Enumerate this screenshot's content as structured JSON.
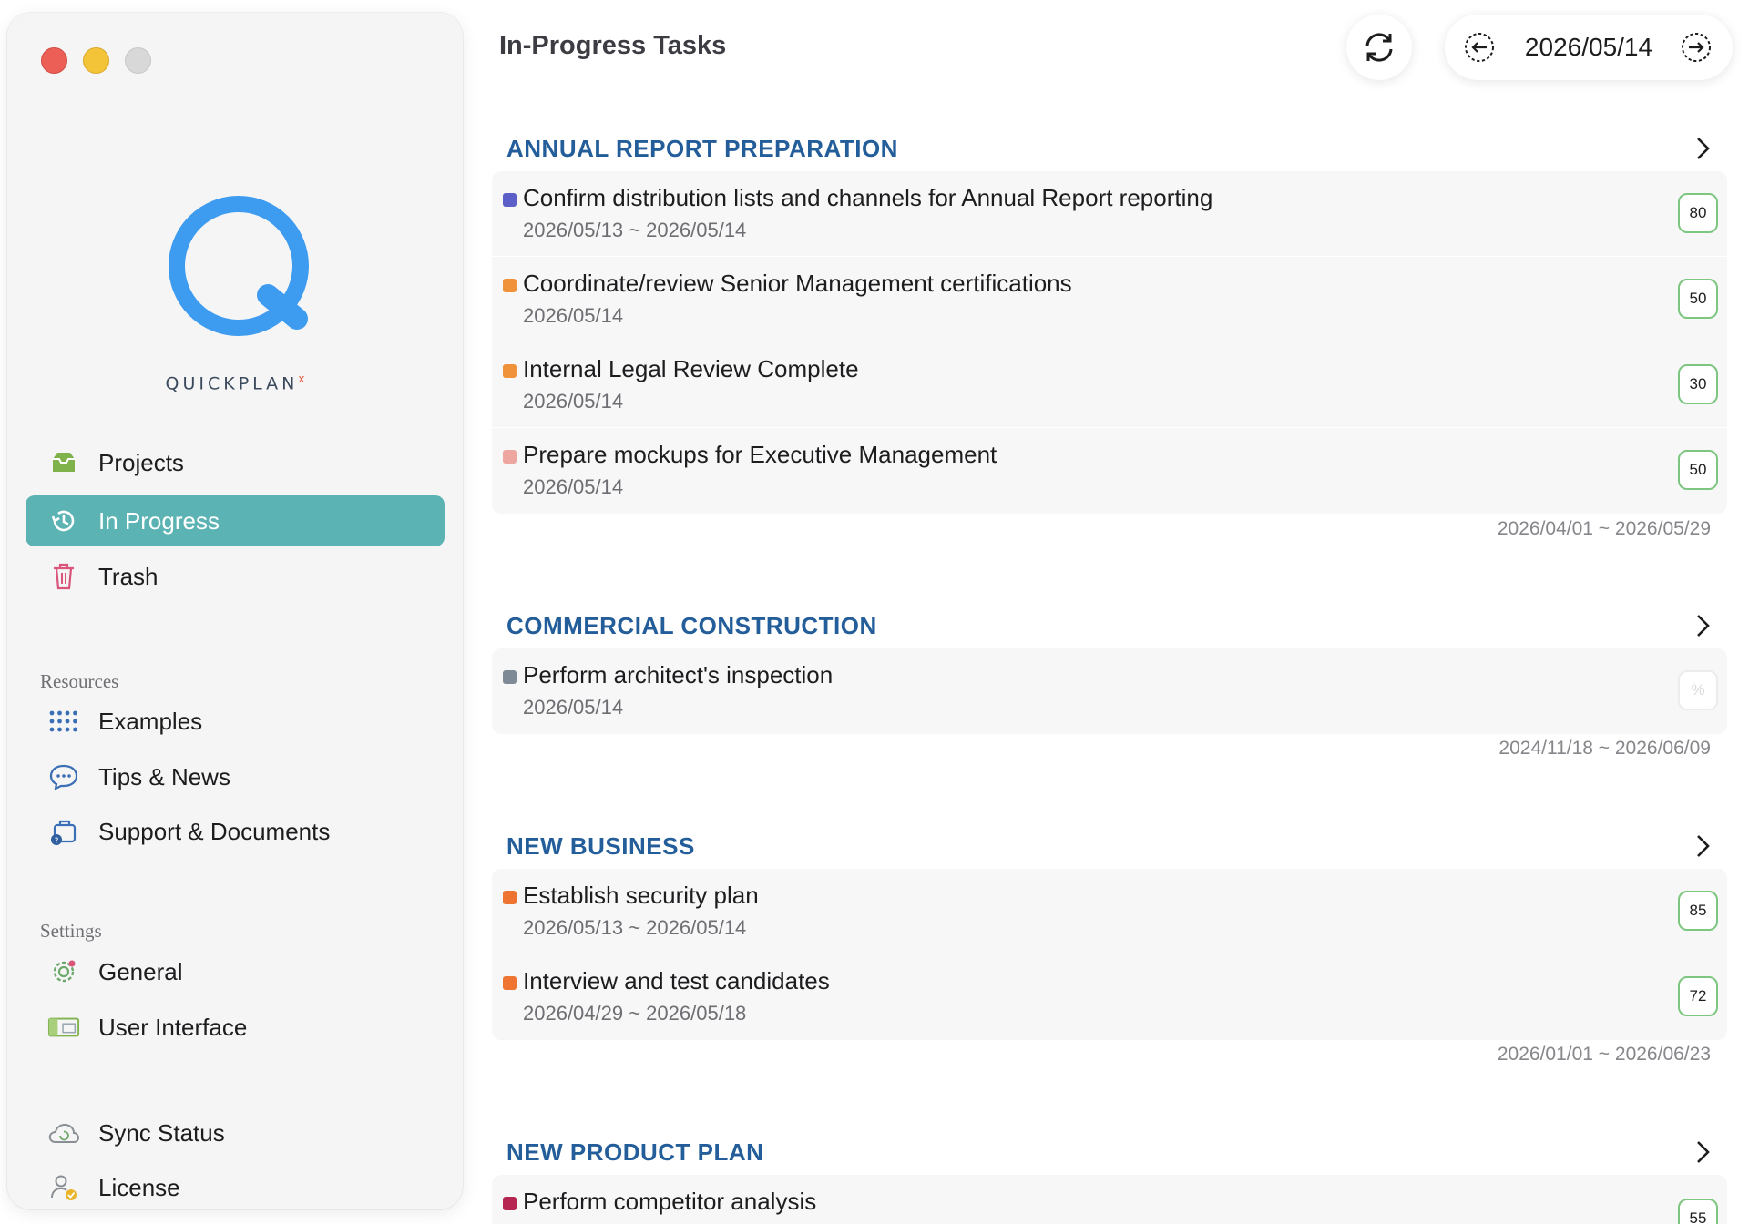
{
  "window": {
    "controls": [
      "close",
      "minimize",
      "zoom"
    ]
  },
  "brand": {
    "name": "QUICKPLAN",
    "mark": "x",
    "accent": "#3d9bf0"
  },
  "sidebar": {
    "nav": [
      {
        "label": "Projects",
        "icon": "tray-icon"
      },
      {
        "label": "In Progress",
        "icon": "clock-arrow-icon",
        "active": true
      },
      {
        "label": "Trash",
        "icon": "trash-icon"
      }
    ],
    "resources": {
      "header": "Resources",
      "items": [
        {
          "label": "Examples",
          "icon": "grid-dots-icon"
        },
        {
          "label": "Tips & News",
          "icon": "chat-bubble-icon"
        },
        {
          "label": "Support & Documents",
          "icon": "briefcase-help-icon"
        }
      ]
    },
    "settings": {
      "header": "Settings",
      "items": [
        {
          "label": "General",
          "icon": "gear-icon"
        },
        {
          "label": "User Interface",
          "icon": "window-icon"
        }
      ]
    },
    "footer": [
      {
        "label": "Sync Status",
        "icon": "cloud-sync-icon"
      },
      {
        "label": "License",
        "icon": "user-badge-icon"
      }
    ],
    "active_color": "#5cb3b3"
  },
  "header": {
    "title": "In-Progress Tasks",
    "current_date": "2026/05/14"
  },
  "projects": [
    {
      "name": "ANNUAL REPORT PREPARATION",
      "range": "2026/04/01 ~ 2026/05/29",
      "tasks": [
        {
          "name": "Confirm distribution lists and channels for Annual Report reporting",
          "dates": "2026/05/13 ~ 2026/05/14",
          "percent": "80",
          "color": "#5b5fc7"
        },
        {
          "name": "Coordinate/review Senior Management certifications",
          "dates": "2026/05/14",
          "percent": "50",
          "color": "#f0923a"
        },
        {
          "name": "Internal Legal Review Complete",
          "dates": "2026/05/14",
          "percent": "30",
          "color": "#f0923a"
        },
        {
          "name": "Prepare mockups for Executive Management",
          "dates": "2026/05/14",
          "percent": "50",
          "color": "#eea7a0"
        }
      ]
    },
    {
      "name": "COMMERCIAL CONSTRUCTION",
      "range": "2024/11/18 ~ 2026/06/09",
      "tasks": [
        {
          "name": "Perform architect's inspection",
          "dates": "2026/05/14",
          "percent": "%",
          "color": "#7e8b96",
          "empty": true
        }
      ]
    },
    {
      "name": "NEW BUSINESS",
      "range": "2026/01/01 ~ 2026/06/23",
      "tasks": [
        {
          "name": "Establish security plan",
          "dates": "2026/05/13 ~ 2026/05/14",
          "percent": "85",
          "color": "#ef7432"
        },
        {
          "name": "Interview and test candidates",
          "dates": "2026/04/29 ~ 2026/05/18",
          "percent": "72",
          "color": "#ef7432"
        }
      ]
    },
    {
      "name": "NEW PRODUCT PLAN",
      "range": "",
      "tasks": [
        {
          "name": "Perform competitor analysis",
          "dates": "",
          "percent": "55",
          "color": "#b5254f"
        }
      ]
    }
  ],
  "colors": {
    "project_title": "#245e9a",
    "percent_border": "#7cc67f"
  }
}
